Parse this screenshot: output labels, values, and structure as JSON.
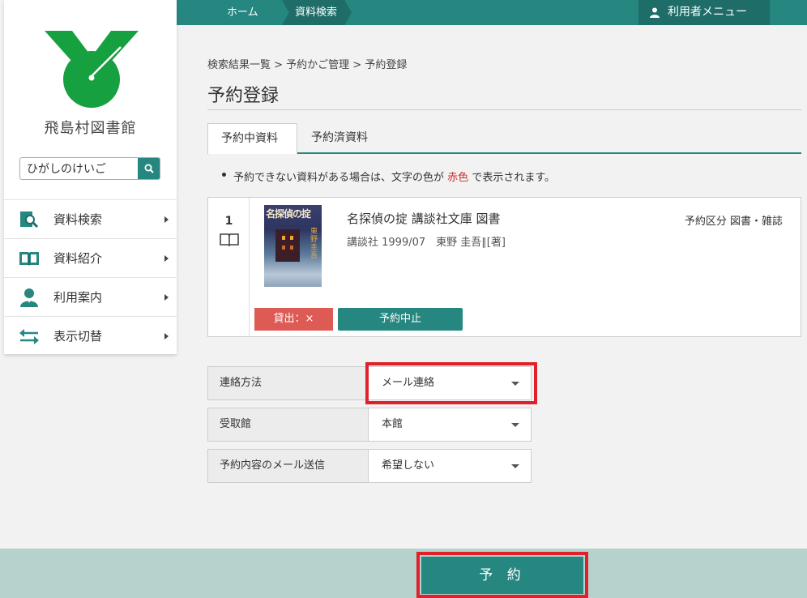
{
  "topbar": {
    "home": "ホーム",
    "search": "資料検索",
    "user_menu": "利用者メニュー"
  },
  "sidebar": {
    "library_name": "飛島村図書館",
    "search_value": "ひがしのけいご",
    "nav": [
      {
        "label": "資料検索",
        "icon": "search-document-icon"
      },
      {
        "label": "資料紹介",
        "icon": "open-book-icon"
      },
      {
        "label": "利用案内",
        "icon": "person-icon"
      },
      {
        "label": "表示切替",
        "icon": "swap-arrows-icon"
      }
    ]
  },
  "breadcrumb": "検索結果一覧 > 予約かご管理 > 予約登録",
  "page_title": "予約登録",
  "tabs": {
    "active": "予約中資料",
    "other": "予約済資料"
  },
  "notice": {
    "before": "予約できない資料がある場合は、文字の色が",
    "red_word": "赤色",
    "after": "で表示されます。"
  },
  "item": {
    "number": "1",
    "cover_title": "名探偵の掟",
    "cover_author": "東野圭吾",
    "title": "名探偵の掟 講談社文庫 図書",
    "meta": "講談社 1999/07　東野 圭吾∥[著]",
    "type": "予約区分 図書・雑誌",
    "lent_status": "貸出：×",
    "cancel_label": "予約中止"
  },
  "form": {
    "contact": {
      "label": "連絡方法",
      "value": "メール連絡"
    },
    "pickup": {
      "label": "受取館",
      "value": "本館"
    },
    "mail": {
      "label": "予約内容のメール送信",
      "value": "希望しない"
    }
  },
  "reserve_button": "予 約",
  "colors": {
    "accent": "#268781",
    "accent_dark": "#1e6d68",
    "alert_red": "#de5a54",
    "highlight": "#e0202a",
    "logo_green": "#16a040"
  }
}
